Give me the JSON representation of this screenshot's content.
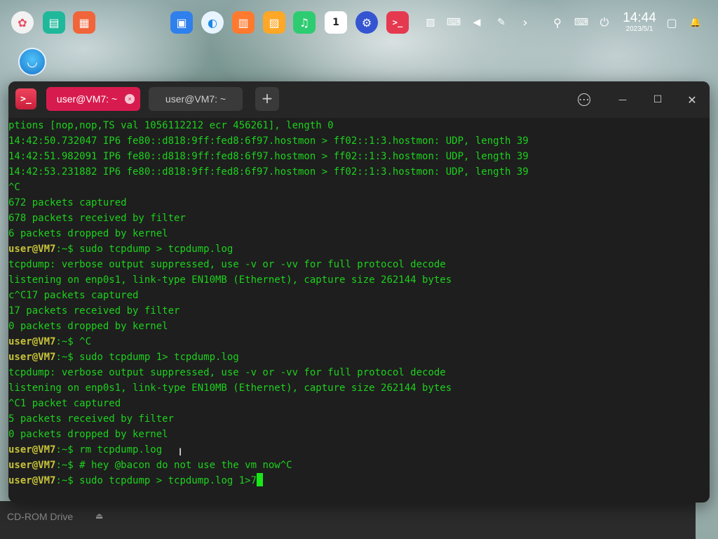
{
  "dock": {
    "apps": [
      {
        "name": "launcher-icon",
        "glyph": "✿",
        "color": "#ffffff"
      },
      {
        "name": "file-manager-icon",
        "glyph": "▤",
        "color": "#1fb89a"
      },
      {
        "name": "app-store-icon",
        "glyph": "▦",
        "color": "#f0653a"
      },
      {
        "name": "package-icon",
        "glyph": "▣",
        "color": "#2f80ed"
      },
      {
        "name": "browser-icon",
        "glyph": "◐",
        "color": "#1e88e5"
      },
      {
        "name": "store-bag-icon",
        "glyph": "▥",
        "color": "#ff7a2f"
      },
      {
        "name": "photos-icon",
        "glyph": "▨",
        "color": "#ffa726"
      },
      {
        "name": "music-icon",
        "glyph": "♫",
        "color": "#2ecc71"
      },
      {
        "name": "calendar-icon",
        "glyph": "1",
        "color": "#ffffff"
      },
      {
        "name": "settings-icon",
        "glyph": "⚙",
        "color": "#3454d1"
      },
      {
        "name": "terminal-icon",
        "glyph": ">_",
        "color": "#e53950"
      }
    ],
    "tray": [
      {
        "name": "screenshot-icon",
        "glyph": "▧"
      },
      {
        "name": "keyboard-layout-icon",
        "glyph": "⌨"
      },
      {
        "name": "volume-icon",
        "glyph": "◀"
      },
      {
        "name": "pen-icon",
        "glyph": "✎"
      },
      {
        "name": "expand-tray-icon",
        "glyph": "›"
      },
      {
        "name": "search-icon",
        "glyph": "⚲"
      },
      {
        "name": "onscreen-keyboard-icon",
        "glyph": "⌨"
      },
      {
        "name": "power-icon",
        "glyph": "⏻"
      }
    ],
    "clock": {
      "time": "14:44",
      "date": "2023/5/1"
    },
    "calendar_day": "1",
    "trash_glyph": "▢",
    "bell_glyph": "🔔"
  },
  "desktop": {
    "logo_glyph": "◡"
  },
  "background_window": {
    "drive_label": "CD-ROM Drive",
    "eject_glyph": "⏏"
  },
  "terminal": {
    "app_icon_glyph": ">_",
    "tabs": [
      {
        "label": "user@VM7: ~",
        "active": true
      },
      {
        "label": "user@VM7: ~",
        "active": false
      }
    ],
    "new_tab_glyph": "+",
    "tab_close_glyph": "×",
    "window_buttons": {
      "menu": "⋯",
      "minimize": "—",
      "maximize": "☐",
      "close": "✕"
    },
    "prompt_user": "user@VM7",
    "prompt_sep": ":~$ ",
    "lines": [
      {
        "type": "out",
        "text": "ptions [nop,nop,TS val 1056112212 ecr 456261], length 0"
      },
      {
        "type": "out",
        "text": "14:42:50.732047 IP6 fe80::d818:9ff:fed8:6f97.hostmon > ff02::1:3.hostmon: UDP, length 39"
      },
      {
        "type": "out",
        "text": "14:42:51.982091 IP6 fe80::d818:9ff:fed8:6f97.hostmon > ff02::1:3.hostmon: UDP, length 39"
      },
      {
        "type": "out",
        "text": "14:42:53.231882 IP6 fe80::d818:9ff:fed8:6f97.hostmon > ff02::1:3.hostmon: UDP, length 39"
      },
      {
        "type": "out",
        "text": "^C"
      },
      {
        "type": "out",
        "text": "672 packets captured"
      },
      {
        "type": "out",
        "text": "678 packets received by filter"
      },
      {
        "type": "out",
        "text": "6 packets dropped by kernel"
      },
      {
        "type": "cmd",
        "text": "sudo tcpdump > tcpdump.log"
      },
      {
        "type": "out",
        "text": "tcpdump: verbose output suppressed, use -v or -vv for full protocol decode"
      },
      {
        "type": "out",
        "text": "listening on enp0s1, link-type EN10MB (Ethernet), capture size 262144 bytes"
      },
      {
        "type": "out",
        "text": "c^C17 packets captured"
      },
      {
        "type": "out",
        "text": "17 packets received by filter"
      },
      {
        "type": "out",
        "text": "0 packets dropped by kernel"
      },
      {
        "type": "cmd",
        "text": "^C"
      },
      {
        "type": "cmd",
        "text": "sudo tcpdump 1> tcpdump.log"
      },
      {
        "type": "out",
        "text": "tcpdump: verbose output suppressed, use -v or -vv for full protocol decode"
      },
      {
        "type": "out",
        "text": "listening on enp0s1, link-type EN10MB (Ethernet), capture size 262144 bytes"
      },
      {
        "type": "out",
        "text": "^C1 packet captured"
      },
      {
        "type": "out",
        "text": "5 packets received by filter"
      },
      {
        "type": "out",
        "text": "0 packets dropped by kernel"
      },
      {
        "type": "cmd",
        "text": "rm tcpdump.log"
      },
      {
        "type": "cmd",
        "text": "# hey @bacon do not use the vm now^C"
      },
      {
        "type": "cmd",
        "text": "sudo tcpdump > tcpdump.log 1>7",
        "cursor": true
      }
    ]
  }
}
